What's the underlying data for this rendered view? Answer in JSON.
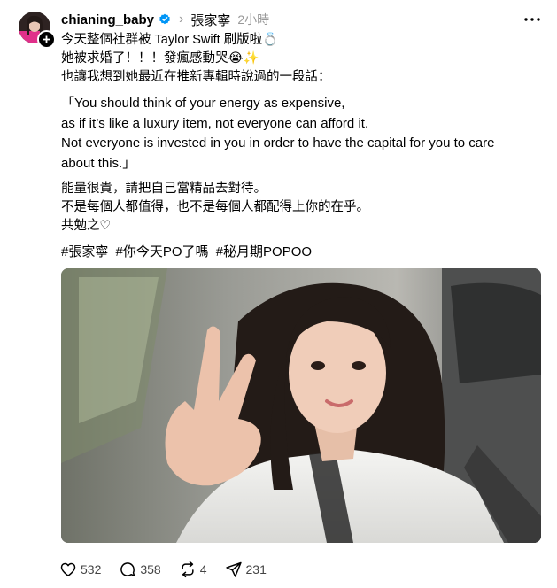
{
  "post": {
    "username": "chianing_baby",
    "separator": "›",
    "tag": "張家寧",
    "time": "2小時",
    "lines": [
      "今天整個社群被 Taylor Swift 刷版啦💍",
      "她被求婚了！！！發瘋感動哭😭✨",
      "也讓我想到她最近在推新專輯時說過的一段話："
    ],
    "quote_lines": [
      "「You should think of your energy as expensive,",
      "as if it’s like a luxury item, not everyone can afford it.",
      "Not everyone is invested in you in order to have the capital for you to care",
      "about this.」"
    ],
    "closing_lines": [
      "能量很貴，請把自己當精品去對待。",
      "不是每個人都值得，也不是每個人都配得上你的在乎。",
      "共勉之♡"
    ],
    "hashtags": [
      "#張家寧",
      "#你今天PO了嗎",
      "#秘月期POPOO"
    ]
  },
  "actions": {
    "likes": "532",
    "comments": "358",
    "reposts": "4",
    "shares": "231"
  },
  "icons": {
    "verified": "verified-badge-icon",
    "more": "more-dots-icon",
    "like": "heart-icon",
    "comment": "comment-icon",
    "repost": "repost-icon",
    "share": "send-icon",
    "follow": "plus-icon"
  },
  "colors": {
    "text": "#000000",
    "secondary": "#999999",
    "verified": "#0095f6"
  }
}
